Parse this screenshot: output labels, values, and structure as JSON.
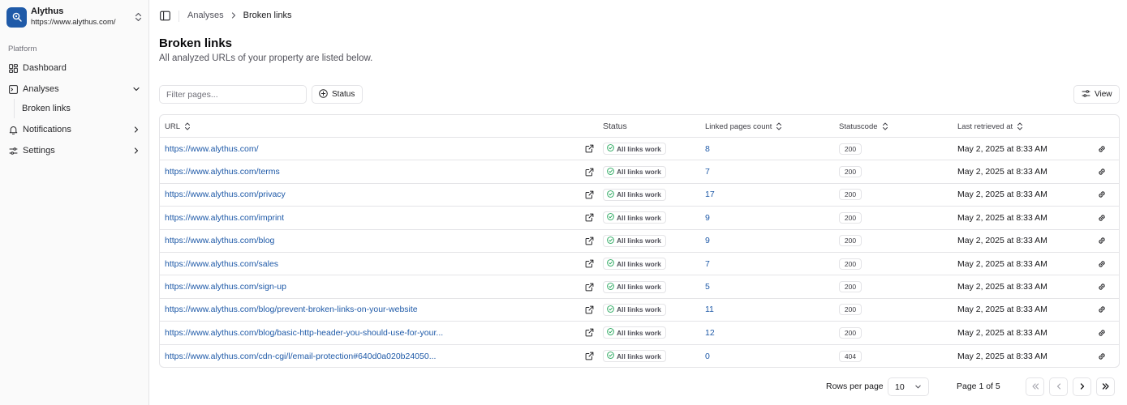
{
  "org": {
    "name": "Alythus",
    "url": "https://www.alythus.com/"
  },
  "sidebar": {
    "group_label": "Platform",
    "items": [
      {
        "label": "Dashboard",
        "icon": "dashboard-icon"
      },
      {
        "label": "Analyses",
        "icon": "analyses-icon",
        "expanded": true
      },
      {
        "label": "Notifications",
        "icon": "bell-icon"
      },
      {
        "label": "Settings",
        "icon": "settings-icon"
      }
    ],
    "sub_items": [
      {
        "label": "Broken links"
      }
    ]
  },
  "breadcrumb": {
    "parent": "Analyses",
    "current": "Broken links"
  },
  "page": {
    "title": "Broken links",
    "subtitle": "All analyzed URLs of your property are listed below."
  },
  "toolbar": {
    "filter_placeholder": "Filter pages...",
    "status_label": "Status",
    "view_label": "View"
  },
  "table": {
    "headers": {
      "url": "URL",
      "status": "Status",
      "linked": "Linked pages count",
      "code": "Statuscode",
      "retrieved": "Last retrieved at"
    },
    "rows": [
      {
        "url": "https://www.alythus.com/",
        "status": "All links work",
        "count": "8",
        "code": "200",
        "date": "May 2, 2025 at 8:33 AM"
      },
      {
        "url": "https://www.alythus.com/terms",
        "status": "All links work",
        "count": "7",
        "code": "200",
        "date": "May 2, 2025 at 8:33 AM"
      },
      {
        "url": "https://www.alythus.com/privacy",
        "status": "All links work",
        "count": "17",
        "code": "200",
        "date": "May 2, 2025 at 8:33 AM"
      },
      {
        "url": "https://www.alythus.com/imprint",
        "status": "All links work",
        "count": "9",
        "code": "200",
        "date": "May 2, 2025 at 8:33 AM"
      },
      {
        "url": "https://www.alythus.com/blog",
        "status": "All links work",
        "count": "9",
        "code": "200",
        "date": "May 2, 2025 at 8:33 AM"
      },
      {
        "url": "https://www.alythus.com/sales",
        "status": "All links work",
        "count": "7",
        "code": "200",
        "date": "May 2, 2025 at 8:33 AM"
      },
      {
        "url": "https://www.alythus.com/sign-up",
        "status": "All links work",
        "count": "5",
        "code": "200",
        "date": "May 2, 2025 at 8:33 AM"
      },
      {
        "url": "https://www.alythus.com/blog/prevent-broken-links-on-your-website",
        "status": "All links work",
        "count": "11",
        "code": "200",
        "date": "May 2, 2025 at 8:33 AM"
      },
      {
        "url": "https://www.alythus.com/blog/basic-http-header-you-should-use-for-your...",
        "status": "All links work",
        "count": "12",
        "code": "200",
        "date": "May 2, 2025 at 8:33 AM"
      },
      {
        "url": "https://www.alythus.com/cdn-cgi/l/email-protection#640d0a020b24050...",
        "status": "All links work",
        "count": "0",
        "code": "404",
        "date": "May 2, 2025 at 8:33 AM"
      }
    ]
  },
  "pagination": {
    "rows_label": "Rows per page",
    "rows_value": "10",
    "page_label": "Page 1 of 5"
  },
  "colors": {
    "accent": "#1f5aa8",
    "success": "#22a559",
    "border": "#e4e4e7"
  }
}
